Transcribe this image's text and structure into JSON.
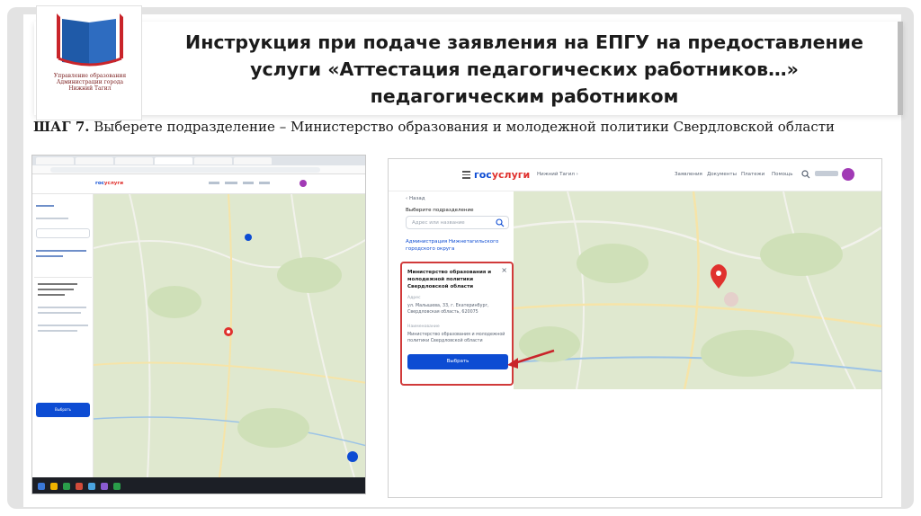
{
  "logo": {
    "caption_line1": "Управление образования",
    "caption_line2": "Администрации города",
    "caption_line3": "Нижний Тагил",
    "colors": {
      "blue": "#1f5aa8",
      "red": "#c9242a"
    }
  },
  "header": {
    "title_line1": "Инструкция при подаче заявления на ЕПГУ на предоставление",
    "title_line2": "услуги «Аттестация педагогических работников…»",
    "title_line3": "педагогическим работником"
  },
  "step": {
    "label": "ШАГ 7.",
    "text": " Выберете подразделение – Министерство образования и молодежной политики Свердловской области"
  },
  "right_screen": {
    "brand_a": "гос",
    "brand_b": "услуги",
    "location": "Нижний Тагил ›",
    "nav": [
      "Заявления",
      "Документы",
      "Платежи",
      "Помощь"
    ],
    "back_link": "‹ Назад",
    "select_label": "Выберите подразделение",
    "search_placeholder": "Адрес или название",
    "admin_link": "Администрация Нижнетагильского городского округа",
    "card": {
      "title": "Министерство образования и молодежной политики Свердловской области",
      "address_label": "Адрес",
      "address_value": "ул. Малышева, 33, г. Екатеринбург, Свердловская область, 620075",
      "name_label": "Наименование",
      "name_value": "Министерство образования и молодежной политики Свердловской области",
      "select_button": "Выбрать"
    }
  },
  "left_screen": {
    "brand_a": "гос",
    "brand_b": "услуги",
    "select_button": "Выбрать"
  },
  "colors": {
    "accent": "#0d4cd3",
    "highlight": "#d13a3a",
    "map": "#dfe8cf",
    "marker": "#e0312e"
  }
}
